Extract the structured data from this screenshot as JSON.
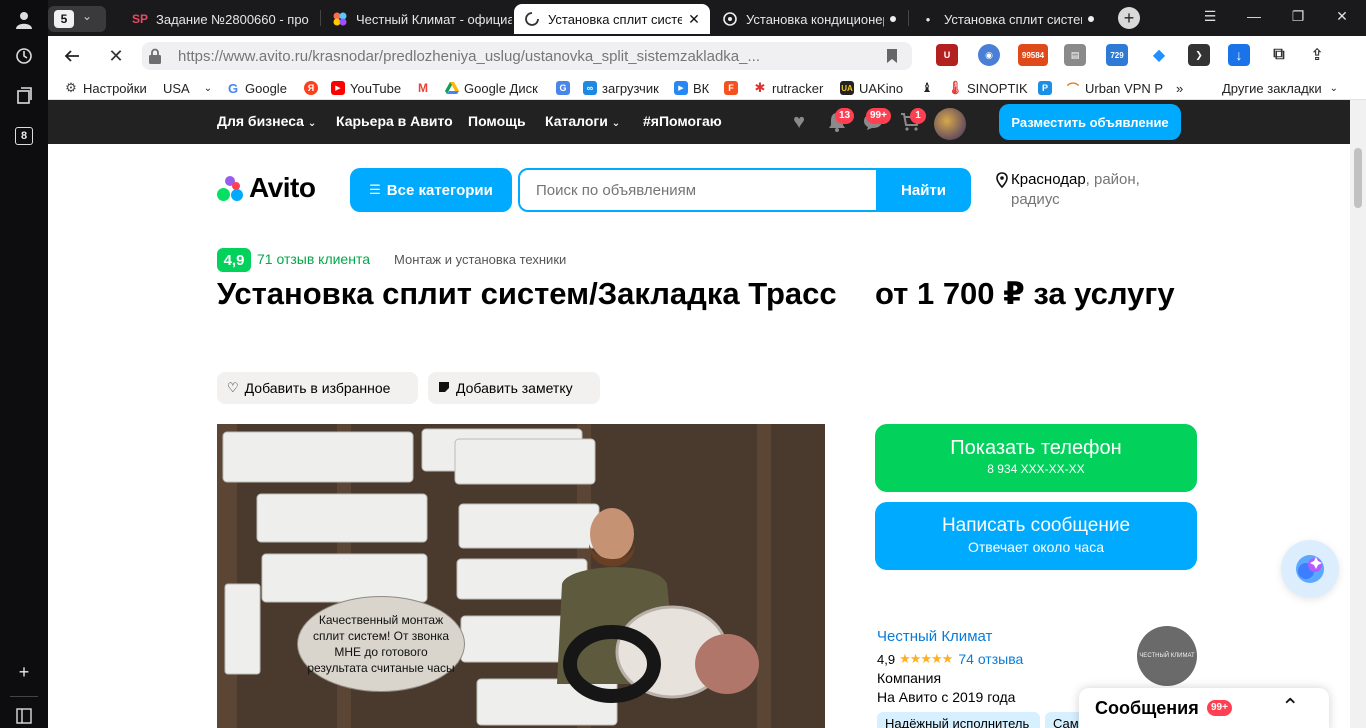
{
  "browser": {
    "tab_count": "5",
    "tabs": [
      {
        "label": "Задание №2800660 - про",
        "favicon": "SP",
        "active": false
      },
      {
        "label": "Честный Климат - официал",
        "favicon": "colorful-app-icon",
        "active": false
      },
      {
        "label": "Установка сплит систем",
        "favicon": "loading-spinner-icon",
        "active": true
      },
      {
        "label": "Установка кондиционеров",
        "favicon": "github-icon",
        "active": false
      },
      {
        "label": "Установка сплит систем",
        "favicon": "dot-icon",
        "active": false
      }
    ],
    "url_host": "https://www.avito.ru",
    "url_path": "/krasnodar/predlozheniya_uslug/ustanovka_split_sistemzakladka_...",
    "extension_badges": {
      "counter": "99584",
      "calendar": "729"
    },
    "bookmarks": [
      {
        "label": "Настройки",
        "icon": "gear-icon"
      },
      {
        "label": "USA",
        "icon": "dropdown-icon"
      },
      {
        "label": "Google",
        "icon": "google-icon"
      },
      {
        "label": "",
        "icon": "yandex-icon"
      },
      {
        "label": "YouTube",
        "icon": "youtube-icon"
      },
      {
        "label": "",
        "icon": "gmail-icon"
      },
      {
        "label": "Google Диск",
        "icon": "google-drive-icon"
      },
      {
        "label": "",
        "icon": "translate-icon"
      },
      {
        "label": "загрузчик",
        "icon": "infinity-icon"
      },
      {
        "label": "ВК",
        "icon": "vk-icon"
      },
      {
        "label": "",
        "icon": "f-icon"
      },
      {
        "label": "rutracker",
        "icon": "rutracker-icon"
      },
      {
        "label": "UAKino",
        "icon": "uakino-icon"
      },
      {
        "label": "",
        "icon": "chess-icon"
      },
      {
        "label": "SINOPTIK",
        "icon": "thermometer-icon"
      },
      {
        "label": "",
        "icon": "p-icon"
      },
      {
        "label": "Urban VPN P",
        "icon": "rainbow-icon"
      }
    ],
    "bookmarks_more": "»",
    "other_bookmarks": "Другие закладки"
  },
  "avito": {
    "topnav": {
      "business": "Для бизнеса",
      "career": "Карьера в Авито",
      "help": "Помощь",
      "catalogs": "Каталоги",
      "help_tag": "#яПомогаю",
      "notifications_badge": "13",
      "messages_badge": "99+",
      "cart_badge": "1",
      "post_ad": "Разместить объявление"
    },
    "logo": "Avito",
    "all_categories": "Все категории",
    "search_placeholder": "Поиск по объявлениям",
    "find": "Найти",
    "location_city": "Краснодар",
    "location_rest": ", район,",
    "location_rest2": "радиус",
    "rating": "4,9",
    "reviews_link": "71 отзыв клиента",
    "category": "Монтаж и установка техники",
    "title": "Установка сплит систем/Закладка Трасс",
    "price": "от 1 700 ₽ за услугу",
    "add_favorite": "Добавить в избранное",
    "add_note": "Добавить заметку",
    "photo_caption": "Качественный монтаж сплит систем! От звонка МНЕ до готового результата считаные часы",
    "show_phone": "Показать телефон",
    "phone_masked": "8 934 XXX-XX-XX",
    "write_message": "Написать сообщение",
    "reply_time": "Отвечает около часа",
    "seller_name": "Честный Климат",
    "seller_rating": "4,9",
    "seller_stars": "★★★★★",
    "seller_reviews": "74 отзыва",
    "seller_type": "Компания",
    "seller_since": "На Авито с 2019 года",
    "avatar_text": "ЧЕСТНЫЙ КЛИМАТ",
    "tags": [
      "Надёжный исполнитель",
      "Сам"
    ],
    "chat_title": "Сообщения",
    "chat_badge": "99+"
  }
}
